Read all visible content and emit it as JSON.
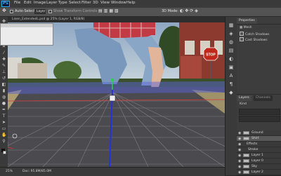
{
  "menu": {
    "items": [
      "File",
      "Edit",
      "Image",
      "Layer",
      "Type",
      "Select",
      "Filter",
      "3D",
      "View",
      "Window",
      "Help"
    ]
  },
  "options": {
    "auto_select_label": "Auto-Select:",
    "auto_select_value": "Layer",
    "show_transform_label": "Show Transform Controls",
    "mode_label": "3D Mode:"
  },
  "document": {
    "tab_title": "Lisen_ExtendedL.psd @ 25% (Layer 1, RGB/8)"
  },
  "status": {
    "zoom": "25%",
    "doc_info": "Doc: 95.8M/85.0M"
  },
  "panels": {
    "properties_tab": "Properties",
    "mesh_label": "Mesh",
    "catch_shadows": "Catch Shadows",
    "cast_shadows": "Cast Shadows",
    "layers_tab": "Layers",
    "channels_tab": "Channels",
    "kind_label": "Kind",
    "layers": [
      {
        "name": "Ground",
        "selected": false
      },
      {
        "name": "Shirt",
        "selected": true
      },
      {
        "name": "Effects",
        "selected": false
      },
      {
        "name": "Stroke",
        "selected": false
      },
      {
        "name": "Layer 1",
        "selected": false
      },
      {
        "name": "Layer 0",
        "selected": false
      },
      {
        "name": "Sky",
        "selected": false
      },
      {
        "name": "Layer 2",
        "selected": false
      }
    ]
  },
  "canvas": {
    "stop_sign_text": "STOP"
  },
  "colors": {
    "accent": "#31a8ff",
    "panel_bg": "#3d3d3d",
    "menubar_bg": "#3a3a3a",
    "options_bg": "#535353",
    "grid_line": "#7a7a7a"
  }
}
